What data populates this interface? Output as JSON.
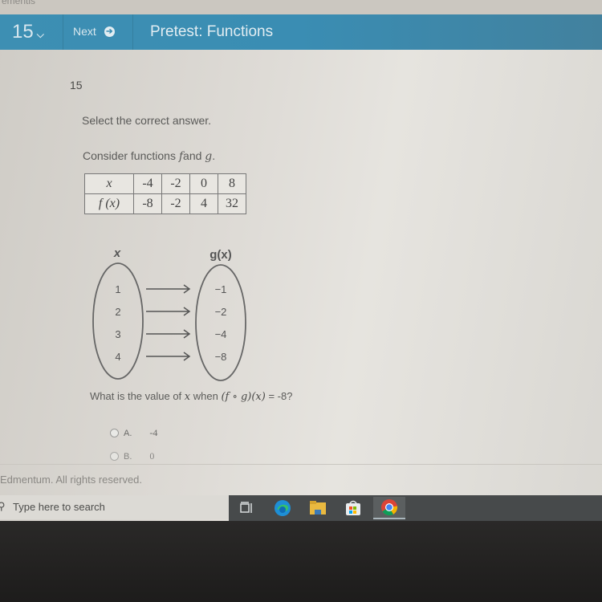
{
  "top_strip": {
    "crumb": "ementis"
  },
  "navbar": {
    "question_number": "15",
    "question_dropdown_icon": "chevron-down-icon",
    "next_label": "Next",
    "next_icon": "arrow-right-circle-icon",
    "title": "Pretest: Functions",
    "color": "#3d8fb3"
  },
  "question": {
    "number": "15",
    "instruction": "Select the correct answer.",
    "consider_prefix": "Consider functions ",
    "consider_f": "f",
    "consider_and": "and ",
    "consider_g": "g",
    "consider_suffix": ".",
    "table": {
      "row_headers": [
        "x",
        "f (x)"
      ],
      "x_values": [
        "-4",
        "-2",
        "0",
        "8"
      ],
      "fx_values": [
        "-8",
        "-2",
        "4",
        "32"
      ]
    },
    "mapping": {
      "domain_label": "x",
      "range_label": "g(x)",
      "domain": [
        "1",
        "2",
        "3",
        "4"
      ],
      "range": [
        "−1",
        "−2",
        "−4",
        "−8"
      ]
    },
    "prompt_prefix": "What is the value of ",
    "prompt_var": "x",
    "prompt_when": " when ",
    "prompt_expr": "(f ∘ g)(x)",
    "prompt_eq": " = ",
    "prompt_value": "-8?",
    "choices": [
      {
        "letter": "A.",
        "value": "-4"
      },
      {
        "letter": "B.",
        "value": "0"
      }
    ]
  },
  "footer": {
    "copyright": "Edmentum. All rights reserved."
  },
  "taskbar": {
    "search_placeholder": "Type here to search",
    "icons": [
      "task-view-icon",
      "edge-icon",
      "file-explorer-icon",
      "store-icon",
      "chrome-icon"
    ]
  }
}
